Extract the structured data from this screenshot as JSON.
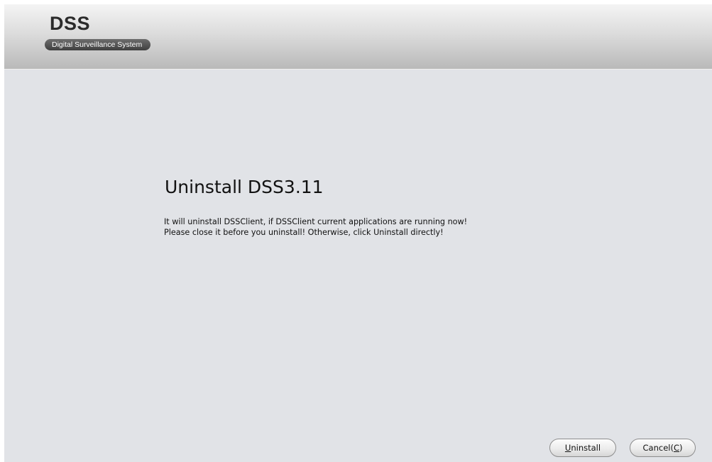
{
  "header": {
    "logo_title": "DSS",
    "logo_subtitle": "Digital Surveillance System"
  },
  "main": {
    "heading": "Uninstall DSS3.11",
    "description_lines": [
      "It will uninstall DSSClient, if DSSClient current applications are running now!",
      "Please close it before you uninstall! Otherwise, click Uninstall directly!"
    ]
  },
  "buttons": {
    "uninstall": {
      "mnemonic": "U",
      "rest": "ninstall"
    },
    "cancel": {
      "prefix": "Cancel(",
      "mnemonic": "C",
      "suffix": ")"
    }
  }
}
